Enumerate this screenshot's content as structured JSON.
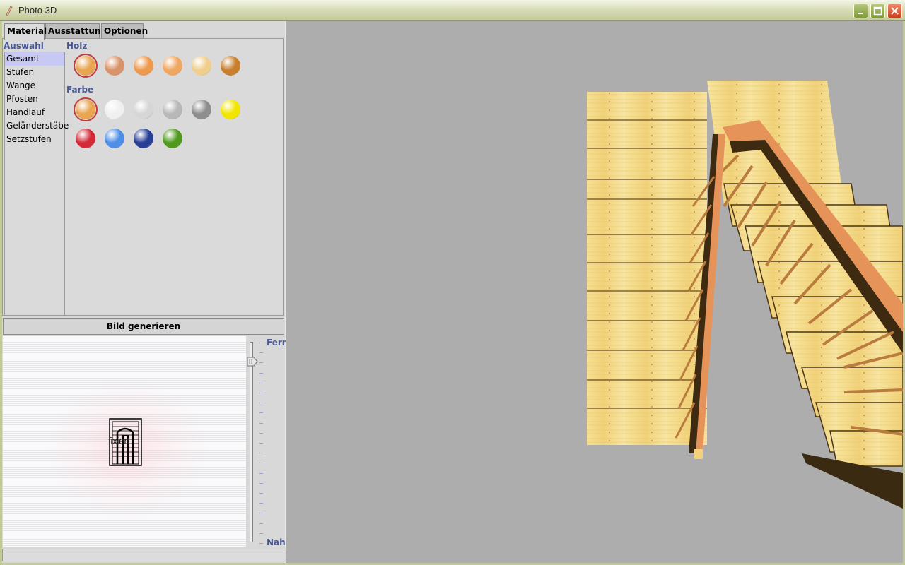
{
  "window": {
    "title": "Photo 3D",
    "controls": [
      "minimize-icon",
      "maximize-icon",
      "close-icon"
    ]
  },
  "tabs": [
    {
      "label": "Material",
      "active": true
    },
    {
      "label": "Ausstattung",
      "active": false
    },
    {
      "label": "Optionen",
      "active": false
    }
  ],
  "material": {
    "auswahl_label": "Auswahl",
    "items": [
      "Gesamt",
      "Stufen",
      "Wange",
      "Pfosten",
      "Handlauf",
      "Geländerstäbe",
      "Setzstufen"
    ],
    "selected_index": 0,
    "holz_label": "Holz",
    "holz_swatches": [
      "#e9a54f",
      "#d9936a",
      "#ee9a4e",
      "#f0a761",
      "#f0cf8e",
      "#c8802e"
    ],
    "holz_selected_index": 0,
    "farbe_label": "Farbe",
    "farbe_swatches": [
      "#e9a54f",
      "#f0f0f0",
      "#d6d6d6",
      "#b8b8b8",
      "#8e8e8e",
      "#f2e600",
      "#d42a38",
      "#4d8ee6",
      "#263e94",
      "#4f9a1e"
    ],
    "farbe_selected_index": 0
  },
  "generate_button": "Bild generieren",
  "preview": {
    "label": "fixiert"
  },
  "distance_slider": {
    "far_label": "Fern",
    "near_label": "Nah"
  },
  "colors": {
    "accent_label": "#4a5a96",
    "selection": "#c8c8f4",
    "viewport_bg": "#adadad"
  }
}
